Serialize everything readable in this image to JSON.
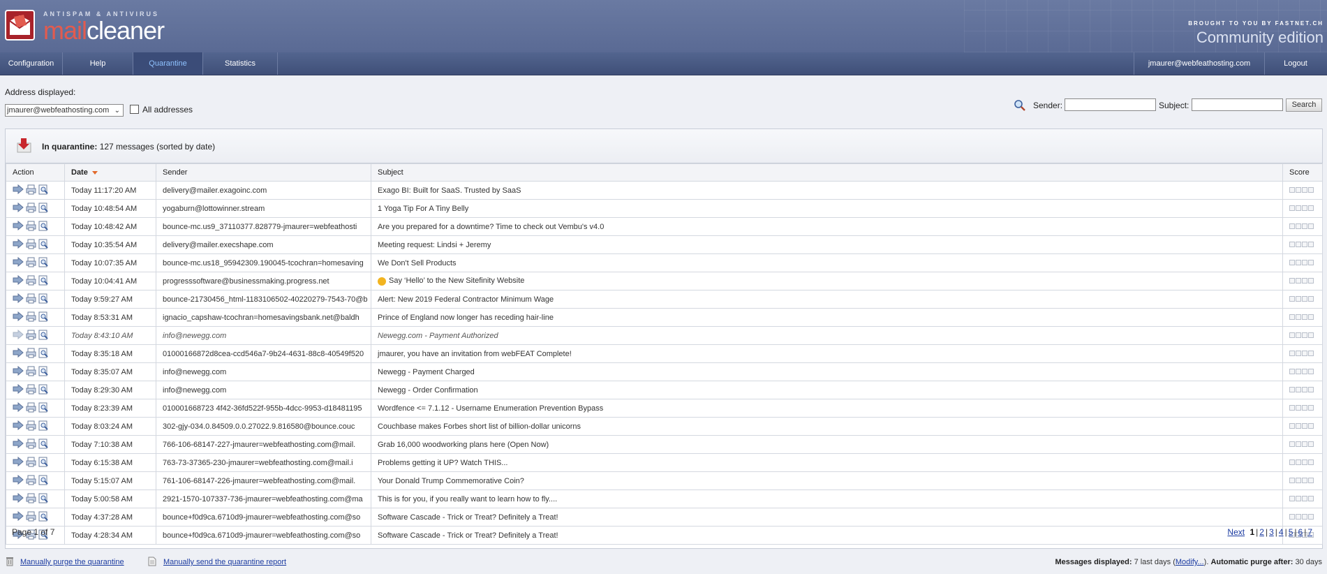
{
  "header": {
    "tagline": "ANTISPAM & ANTIVIRUS",
    "logo_part1": "mail",
    "logo_part2": "cleaner",
    "brought_by": "BROUGHT TO YOU BY FASTNET.CH",
    "edition": "Community edition"
  },
  "nav": {
    "items": [
      {
        "label": "Configuration"
      },
      {
        "label": "Help"
      },
      {
        "label": "Quarantine",
        "active": true
      },
      {
        "label": "Statistics"
      }
    ],
    "user": "jmaurer@webfeathosting.com",
    "logout": "Logout"
  },
  "filters": {
    "address_label": "Address displayed:",
    "address_value": "jmaurer@webfeathosting.com",
    "all_addresses_label": "All addresses",
    "all_addresses_checked": false,
    "sender_label": "Sender:",
    "sender_value": "",
    "subject_label": "Subject:",
    "subject_value": "",
    "search_button": "Search"
  },
  "quarantine": {
    "title_bold": "In quarantine:",
    "title_rest": "127 messages (sorted by date)",
    "columns": {
      "action": "Action",
      "date": "Date",
      "sender": "Sender",
      "subject": "Subject",
      "score": "Score"
    },
    "rows": [
      {
        "date": "Today 11:17:20 AM",
        "sender": "delivery@mailer.exagoinc.com",
        "subject": "Exago BI: Built for SaaS. Trusted by SaaS"
      },
      {
        "date": "Today 10:48:54 AM",
        "sender": "yogaburn@lottowinner.stream",
        "subject": "1 Yoga Tip For A Tiny Belly"
      },
      {
        "date": "Today 10:48:42 AM",
        "sender": "bounce-mc.us9_37110377.828779-jmaurer=webfeathosti",
        "subject": "Are you prepared for a downtime? Time to check out Vembu's v4.0"
      },
      {
        "date": "Today 10:35:54 AM",
        "sender": "delivery@mailer.execshape.com",
        "subject": "Meeting request: Lindsi + Jeremy"
      },
      {
        "date": "Today 10:07:35 AM",
        "sender": "bounce-mc.us18_95942309.190045-tcochran=homesaving",
        "subject": "We Don't Sell Products"
      },
      {
        "date": "Today 10:04:41 AM",
        "sender": "progresssoftware@businessmaking.progress.net",
        "subject": "Say ‘Hello’ to the New Sitefinity Website",
        "emoji": true
      },
      {
        "date": "Today 9:59:27 AM",
        "sender": "bounce-21730456_html-1183106502-40220279-7543-70@b",
        "subject": "Alert: New 2019 Federal Contractor Minimum Wage"
      },
      {
        "date": "Today 8:53:31 AM",
        "sender": "ignacio_capshaw-tcochran=homesavingsbank.net@baldh",
        "subject": "Prince of England now longer has receding hair-line"
      },
      {
        "date": "Today 8:43:10 AM",
        "sender": "info@newegg.com",
        "subject": "Newegg.com - Payment Authorized",
        "released": true
      },
      {
        "date": "Today 8:35:18 AM",
        "sender": "01000166872d8cea-ccd546a7-9b24-4631-88c8-40549f520",
        "subject": "jmaurer, you have an invitation from webFEAT Complete!"
      },
      {
        "date": "Today 8:35:07 AM",
        "sender": "info@newegg.com",
        "subject": "Newegg - Payment Charged"
      },
      {
        "date": "Today 8:29:30 AM",
        "sender": "info@newegg.com",
        "subject": "Newegg - Order Confirmation"
      },
      {
        "date": "Today 8:23:39 AM",
        "sender": "010001668723 4f42-36fd522f-955b-4dcc-9953-d18481195",
        "subject": "Wordfence <= 7.1.12 - Username Enumeration Prevention Bypass"
      },
      {
        "date": "Today 8:03:24 AM",
        "sender": "302-gjy-034.0.84509.0.0.27022.9.816580@bounce.couc",
        "subject": "Couchbase makes Forbes short list of billion-dollar unicorns"
      },
      {
        "date": "Today 7:10:38 AM",
        "sender": "766-106-68147-227-jmaurer=webfeathosting.com@mail.",
        "subject": "Grab 16,000 woodworking plans here (Open Now)"
      },
      {
        "date": "Today 6:15:38 AM",
        "sender": "763-73-37365-230-jmaurer=webfeathosting.com@mail.i",
        "subject": "Problems getting it UP? Watch THIS..."
      },
      {
        "date": "Today 5:15:07 AM",
        "sender": "761-106-68147-226-jmaurer=webfeathosting.com@mail.",
        "subject": "Your Donald Trump Commemorative Coin?"
      },
      {
        "date": "Today 5:00:58 AM",
        "sender": "2921-1570-107337-736-jmaurer=webfeathosting.com@ma",
        "subject": "This is for you, if you really want to learn how to fly...."
      },
      {
        "date": "Today 4:37:28 AM",
        "sender": "bounce+f0d9ca.6710d9-jmaurer=webfeathosting.com@so",
        "subject": "Software Cascade - Trick or Treat? Definitely a Treat!"
      },
      {
        "date": "Today 4:28:34 AM",
        "sender": "bounce+f0d9ca.6710d9-jmaurer=webfeathosting.com@so",
        "subject": "Software Cascade - Trick or Treat? Definitely a Treat!"
      }
    ],
    "page_text": "Page 1 of 7",
    "next": "Next",
    "pages": [
      "1",
      "2",
      "3",
      "4",
      "5",
      "6",
      "7"
    ],
    "current_page": "1"
  },
  "footer": {
    "purge_link": "Manually purge the quarantine",
    "report_link": "Manually send the quarantine report",
    "messages_displayed_label": "Messages displayed:",
    "messages_displayed_value": "7 last days",
    "modify_link": "Modify...",
    "auto_purge_label": "Automatic purge after:",
    "auto_purge_value": "30 days"
  },
  "colors": {
    "header": "#5a6a94",
    "nav": "#3f4f78",
    "active_tab_text": "#8fc2ff",
    "logo_red": "#e25b4f",
    "link": "#1a3aa0"
  },
  "icons": [
    "release-arrow-icon",
    "print-icon",
    "analyze-icon",
    "search-icon",
    "trash-icon",
    "document-icon",
    "quarantine-icon"
  ]
}
